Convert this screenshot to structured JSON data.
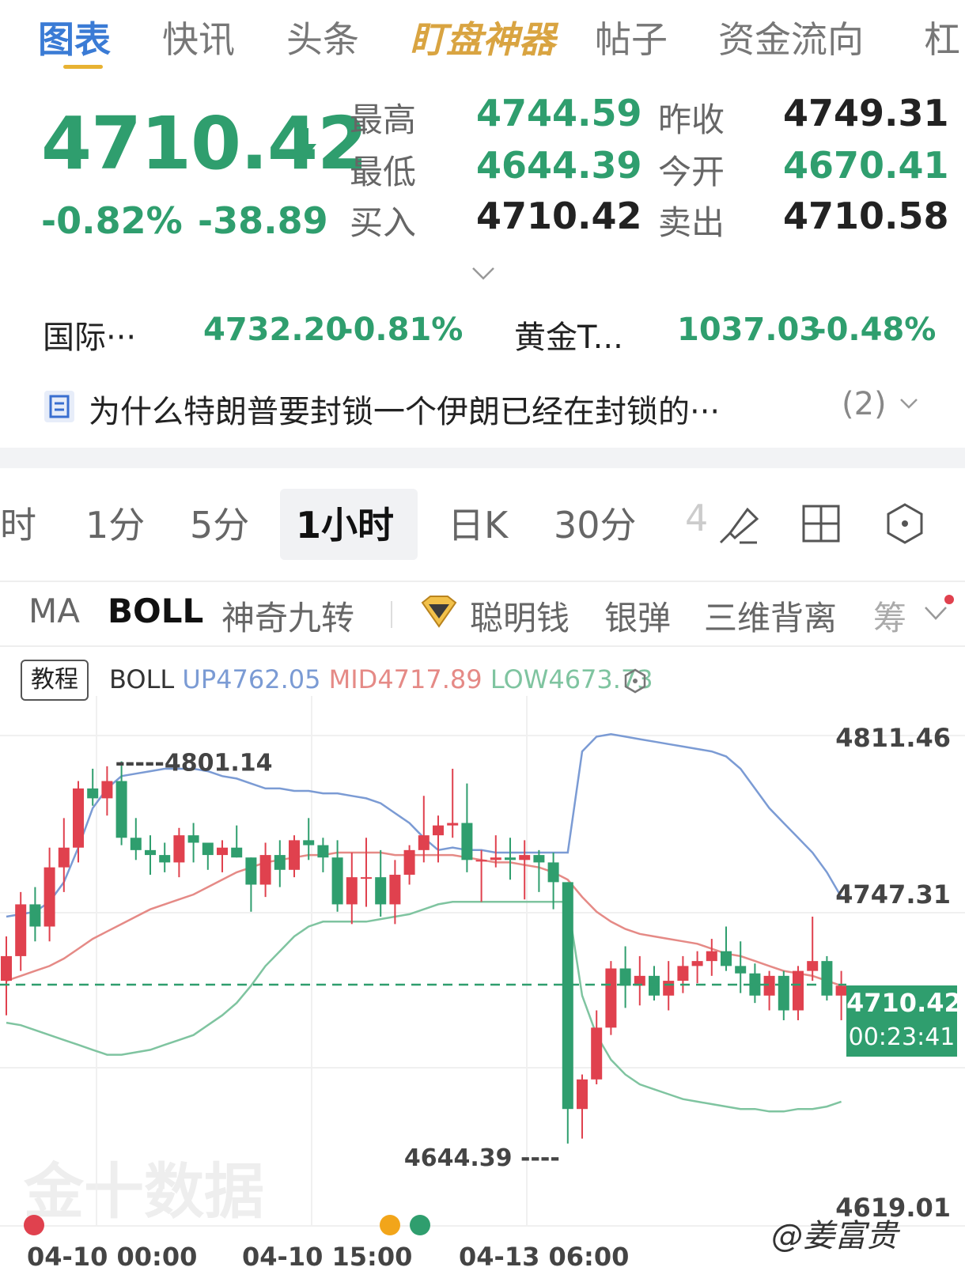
{
  "top_tabs": [
    "图表",
    "快讯",
    "头条",
    "盯盘神器",
    "帖子",
    "资金流向",
    "杠"
  ],
  "quote": {
    "price": "4710.42",
    "change_pct": "-0.82%",
    "change": "-38.89",
    "high_label": "最高",
    "high": "4744.59",
    "low_label": "最低",
    "low": "4644.39",
    "bid_label": "买入",
    "bid": "4710.42",
    "prev_close_label": "昨收",
    "prev_close": "4749.31",
    "open_label": "今开",
    "open": "4670.41",
    "ask_label": "卖出",
    "ask": "4710.58"
  },
  "related": [
    {
      "name": "国际···",
      "value": "4732.20",
      "pct": "-0.81%"
    },
    {
      "name": "黄金T...",
      "value": "1037.03",
      "pct": "-0.48%"
    }
  ],
  "news": {
    "icon": "doc-list-icon",
    "text": "为什么特朗普要封锁一个伊朗已经在封锁的···",
    "count": "(2)"
  },
  "periods": [
    "时",
    "1分",
    "5分",
    "1小时",
    "日K",
    "30分",
    "4"
  ],
  "period_active": "1小时",
  "indicators": [
    "MA",
    "BOLL",
    "神奇九转",
    "聪明钱",
    "银弹",
    "三维背离",
    "筹"
  ],
  "indicator_active": "BOLL",
  "chart_header": {
    "tutorial": "教程",
    "boll": "BOLL",
    "up": "UP4762.05",
    "mid": "MID4717.89",
    "low": "LOW4673.73"
  },
  "colors": {
    "up": "#e0414e",
    "down": "#2f9e6e",
    "boll_up": "#7b9bd4",
    "boll_mid": "#e58a86",
    "boll_low": "#7fc4a0",
    "accent": "#3a7bd5"
  },
  "watermark": "金十数据",
  "author": "@姜富贵",
  "current_price_box": {
    "price": "4710.42",
    "countdown": "00:23:41"
  },
  "chart_data": {
    "type": "candlestick",
    "y_axis_labels": [
      "4811.46",
      "4747.31",
      "4619.01"
    ],
    "ylim": [
      4619.01,
      4811.46
    ],
    "x_axis_labels": [
      "04-10 00:00",
      "04-10 15:00",
      "04-13 06:00"
    ],
    "high_marker": "4801.14",
    "low_marker": "4644.39",
    "last_price": 4710.42,
    "candles": [
      [
        4712,
        4730,
        4698,
        4722
      ],
      [
        4722,
        4748,
        4716,
        4743
      ],
      [
        4743,
        4750,
        4728,
        4734
      ],
      [
        4734,
        4766,
        4728,
        4758
      ],
      [
        4758,
        4778,
        4748,
        4766
      ],
      [
        4766,
        4793,
        4760,
        4790
      ],
      [
        4790,
        4798,
        4783,
        4786
      ],
      [
        4786,
        4799,
        4779,
        4793
      ],
      [
        4793,
        4801,
        4767,
        4770
      ],
      [
        4770,
        4778,
        4761,
        4765
      ],
      [
        4765,
        4771,
        4755,
        4763
      ],
      [
        4763,
        4768,
        4756,
        4760
      ],
      [
        4760,
        4774,
        4754,
        4771
      ],
      [
        4771,
        4776,
        4760,
        4768
      ],
      [
        4768,
        4768,
        4757,
        4763
      ],
      [
        4763,
        4769,
        4756,
        4766
      ],
      [
        4766,
        4775,
        4762,
        4762
      ],
      [
        4762,
        4762,
        4740,
        4751
      ],
      [
        4751,
        4768,
        4746,
        4763
      ],
      [
        4763,
        4769,
        4750,
        4757
      ],
      [
        4757,
        4771,
        4754,
        4769
      ],
      [
        4769,
        4778,
        4761,
        4767
      ],
      [
        4767,
        4770,
        4756,
        4762
      ],
      [
        4762,
        4769,
        4740,
        4743
      ],
      [
        4743,
        4764,
        4735,
        4754
      ],
      [
        4754,
        4770,
        4742,
        4754
      ],
      [
        4754,
        4765,
        4738,
        4743
      ],
      [
        4743,
        4761,
        4735,
        4755
      ],
      [
        4755,
        4767,
        4751,
        4765
      ],
      [
        4765,
        4787,
        4760,
        4771
      ],
      [
        4771,
        4779,
        4760,
        4775
      ],
      [
        4775,
        4798,
        4770,
        4776
      ],
      [
        4776,
        4792,
        4756,
        4761
      ],
      [
        4761,
        4765,
        4744,
        4761
      ],
      [
        4761,
        4771,
        4758,
        4762
      ],
      [
        4762,
        4770,
        4753,
        4761
      ],
      [
        4761,
        4769,
        4745,
        4763
      ],
      [
        4763,
        4765,
        4748,
        4760
      ],
      [
        4760,
        4764,
        4741,
        4752
      ],
      [
        4752,
        4752,
        4646,
        4660
      ],
      [
        4660,
        4674,
        4648,
        4672
      ],
      [
        4672,
        4700,
        4670,
        4693
      ],
      [
        4693,
        4720,
        4690,
        4717
      ],
      [
        4717,
        4726,
        4701,
        4710
      ],
      [
        4710,
        4722,
        4702,
        4714
      ],
      [
        4714,
        4718,
        4704,
        4706
      ],
      [
        4706,
        4720,
        4700,
        4712
      ],
      [
        4712,
        4722,
        4707,
        4718
      ],
      [
        4718,
        4724,
        4711,
        4720
      ],
      [
        4720,
        4729,
        4714,
        4724
      ],
      [
        4724,
        4734,
        4716,
        4718
      ],
      [
        4718,
        4728,
        4707,
        4715
      ],
      [
        4715,
        4719,
        4703,
        4706
      ],
      [
        4706,
        4716,
        4700,
        4714
      ],
      [
        4714,
        4716,
        4696,
        4700
      ],
      [
        4700,
        4718,
        4696,
        4716
      ],
      [
        4716,
        4738,
        4712,
        4720
      ],
      [
        4720,
        4722,
        4704,
        4706
      ],
      [
        4706,
        4716,
        4696,
        4710
      ]
    ],
    "boll_up": [
      4738,
      4739,
      4740,
      4744,
      4752,
      4766,
      4782,
      4790,
      4795,
      4796,
      4797,
      4798,
      4798,
      4798,
      4797,
      4795,
      4794,
      4792,
      4790,
      4790,
      4789,
      4789,
      4788,
      4788,
      4787,
      4786,
      4784,
      4780,
      4776,
      4770,
      4765,
      4766,
      4765,
      4765,
      4764,
      4764,
      4764,
      4764,
      4764,
      4764,
      4805,
      4811,
      4812,
      4811,
      4810,
      4809,
      4808,
      4807,
      4806,
      4805,
      4803,
      4798,
      4790,
      4782,
      4776,
      4770,
      4764,
      4756,
      4746
    ],
    "boll_mid": [
      4712,
      4714,
      4716,
      4718,
      4721,
      4725,
      4729,
      4732,
      4735,
      4738,
      4741,
      4743,
      4745,
      4747,
      4750,
      4753,
      4756,
      4758,
      4760,
      4761,
      4762,
      4763,
      4763,
      4764,
      4764,
      4764,
      4764,
      4763,
      4763,
      4763,
      4763,
      4763,
      4762,
      4761,
      4760,
      4760,
      4759,
      4758,
      4756,
      4753,
      4746,
      4740,
      4736,
      4733,
      4731,
      4730,
      4729,
      4728,
      4727,
      4725,
      4723,
      4722,
      4720,
      4718,
      4716,
      4715,
      4714,
      4712,
      4710
    ],
    "boll_low": [
      4695,
      4694,
      4692,
      4690,
      4688,
      4686,
      4684,
      4682,
      4682,
      4683,
      4684,
      4686,
      4688,
      4690,
      4694,
      4698,
      4703,
      4710,
      4718,
      4724,
      4730,
      4734,
      4736,
      4736,
      4736,
      4736,
      4737,
      4738,
      4739,
      4741,
      4743,
      4744,
      4744,
      4744,
      4744,
      4744,
      4744,
      4744,
      4744,
      4744,
      4706,
      4690,
      4680,
      4674,
      4670,
      4668,
      4666,
      4664,
      4663,
      4662,
      4661,
      4660,
      4660,
      4659,
      4659,
      4660,
      4660,
      4661,
      4663
    ]
  }
}
